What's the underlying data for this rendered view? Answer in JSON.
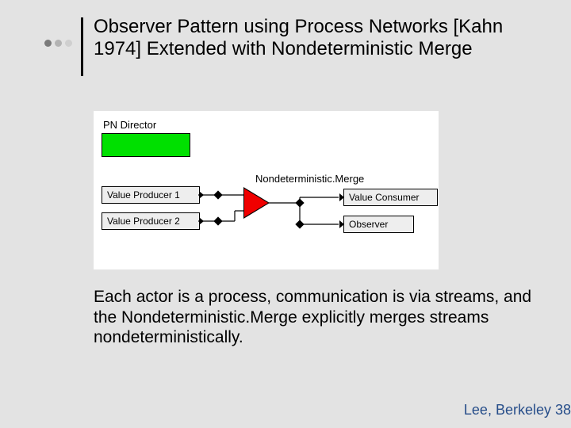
{
  "title": "Observer Pattern using Process Networks [Kahn 1974] Extended with Nondeterministic Merge",
  "caption": "Each actor is a process, communication is via streams, and the Nondeterministic.Merge explicitly merges streams nondeterministically.",
  "footer": "Lee, Berkeley 38",
  "bullets": {
    "colors": [
      "#7a7a7a",
      "#b3b3b3",
      "#cfcfcf"
    ]
  },
  "figure": {
    "pn_director_label": "PN Director",
    "merge_label": "Nondeterministic.Merge",
    "actors": {
      "producer1": "Value Producer 1",
      "producer2": "Value Producer 2",
      "consumer": "Value Consumer",
      "observer": "Observer"
    }
  },
  "chart_data": {
    "type": "diagram",
    "title": "Observer Pattern using Process Networks",
    "nodes": [
      {
        "id": "director",
        "kind": "director",
        "label": "PN Director"
      },
      {
        "id": "producer1",
        "kind": "actor",
        "label": "Value Producer 1"
      },
      {
        "id": "producer2",
        "kind": "actor",
        "label": "Value Producer 2"
      },
      {
        "id": "merge",
        "kind": "merge",
        "label": "Nondeterministic.Merge"
      },
      {
        "id": "consumer",
        "kind": "actor",
        "label": "Value Consumer"
      },
      {
        "id": "observer",
        "kind": "actor",
        "label": "Observer"
      }
    ],
    "edges": [
      {
        "from": "producer1",
        "to": "merge"
      },
      {
        "from": "producer2",
        "to": "merge"
      },
      {
        "from": "merge",
        "to": "consumer"
      },
      {
        "from": "merge",
        "to": "observer"
      }
    ]
  }
}
